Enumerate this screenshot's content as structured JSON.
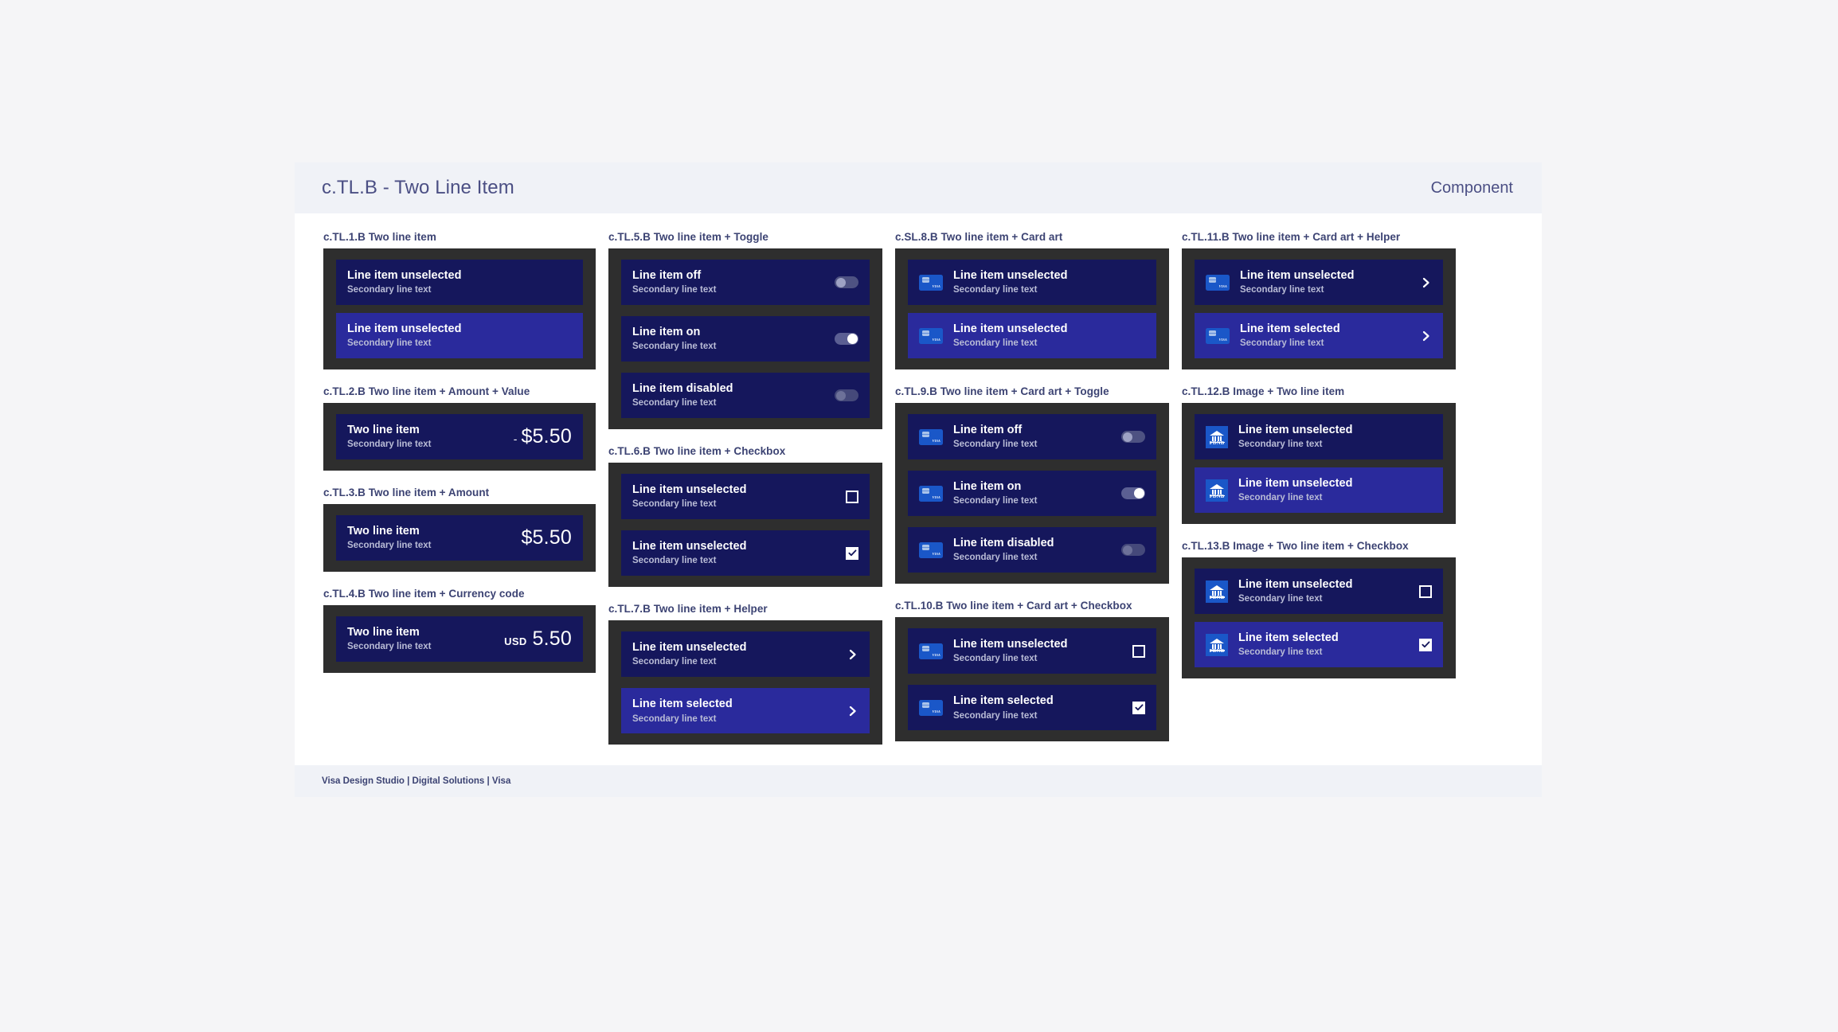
{
  "header": {
    "title": "c.TL.B - Two Line Item",
    "right_label": "Component"
  },
  "footer": {
    "text": "Visa Design Studio | Digital Solutions | Visa"
  },
  "labels": {
    "secondary": "Secondary line text",
    "unselected": "Line item unselected",
    "selected": "Line item selected",
    "two_line_item": "Two line item",
    "off": "Line item off",
    "on": "Line item on",
    "disabled": "Line item disabled"
  },
  "icons": {
    "card_art_brand": "VISA",
    "bank_label": "FDNB",
    "chevron": "chevron-right-icon",
    "check": "check-icon"
  },
  "colors": {
    "panel_bg": "#2e2e2e",
    "row_unselected": "#15175c",
    "row_selected": "#2a2a9c",
    "header_bg": "#f0f2f7",
    "label_text": "#3c4373",
    "title_text": "#4b4f84",
    "card_blue": "#1a57c8",
    "secondary_text": "#b9bcd6"
  },
  "groups": {
    "tl1": {
      "title": "c.TL.1.B Two line item"
    },
    "tl2": {
      "title": "c.TL.2.B Two line item + Amount + Value",
      "sign": "-",
      "value": "$5.50"
    },
    "tl3": {
      "title": "c.TL.3.B Two line item + Amount",
      "value": "$5.50"
    },
    "tl4": {
      "title": "c.TL.4.B Two line item + Currency code",
      "currency": "USD",
      "value": "5.50"
    },
    "tl5": {
      "title": "c.TL.5.B Two line item + Toggle"
    },
    "tl6": {
      "title": "c.TL.6.B Two line item + Checkbox"
    },
    "tl7": {
      "title": "c.TL.7.B Two line item + Helper"
    },
    "sl8": {
      "title": "c.SL.8.B Two line item + Card art"
    },
    "tl9": {
      "title": "c.TL.9.B Two line item + Card art + Toggle"
    },
    "tl10": {
      "title": "c.TL.10.B Two line item + Card art + Checkbox"
    },
    "tl11": {
      "title": "c.TL.11.B Two line item + Card art + Helper"
    },
    "tl12": {
      "title": "c.TL.12.B Image + Two line item"
    },
    "tl13": {
      "title": "c.TL.13.B Image + Two line item + Checkbox"
    }
  }
}
